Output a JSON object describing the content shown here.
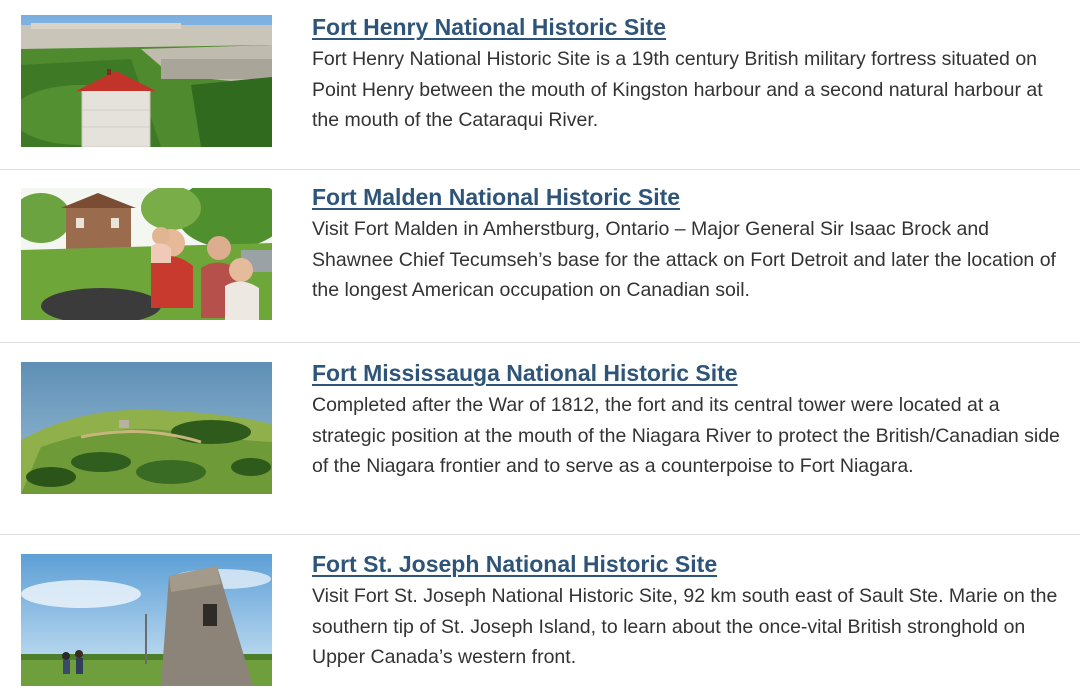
{
  "sites": [
    {
      "title": "Fort Henry National Historic Site",
      "description": "Fort Henry National Historic Site is a 19th century British military fortress situated on Point Henry between the mouth of Kingston harbour and a second natural harbour at the mouth of the Cataraqui River.",
      "image": "fort-henry-photo"
    },
    {
      "title": "Fort Malden National Historic Site",
      "description": "Visit Fort Malden in Amherstburg, Ontario – Major General Sir Isaac Brock and Shawnee Chief Tecumseh’s base for the attack on Fort Detroit and later the location of the longest American occupation on Canadian soil.",
      "image": "fort-malden-photo"
    },
    {
      "title": "Fort Mississauga National Historic Site",
      "description": "Completed after the War of 1812, the fort and its central tower were located at a strategic position at the mouth of the Niagara River to protect the British/Canadian side of the Niagara frontier and to serve as a counterpoise to Fort Niagara.",
      "image": "fort-mississauga-photo"
    },
    {
      "title": "Fort St. Joseph National Historic Site",
      "description": "Visit Fort St. Joseph National Historic Site, 92 km south east of Sault Ste. Marie on the southern tip of St. Joseph Island, to learn about the once-vital British stronghold on Upper Canada’s western front.",
      "image": "fort-st-joseph-photo"
    }
  ]
}
